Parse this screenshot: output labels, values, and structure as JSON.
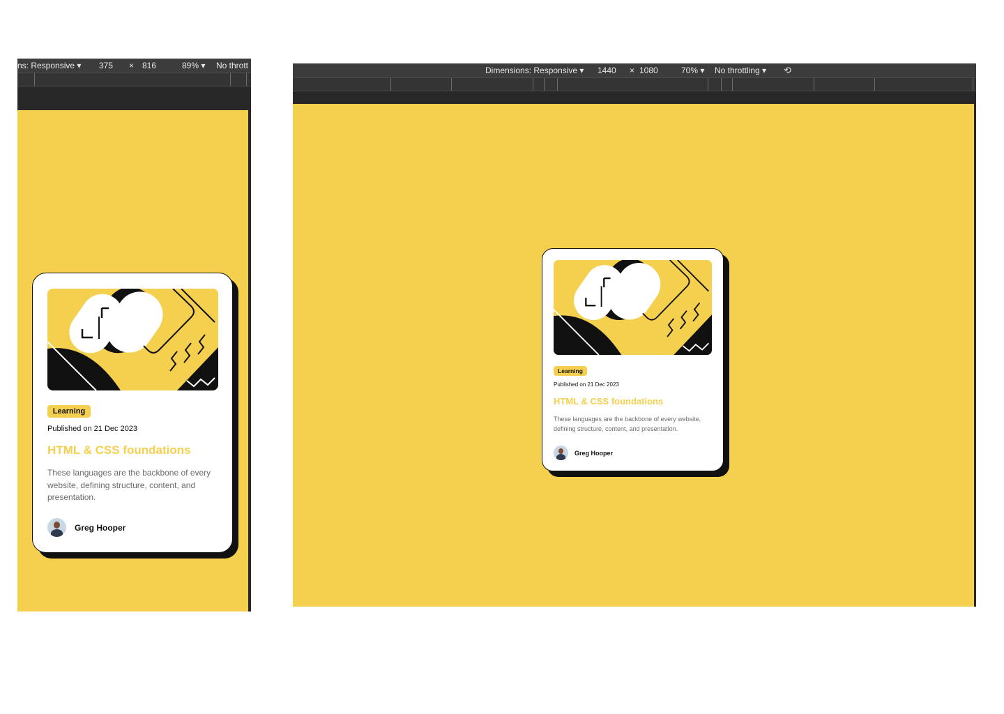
{
  "mobile_preview": {
    "toolbar": {
      "dimensions_label": "ns: Responsive ▾",
      "width": "375",
      "times": "×",
      "height": "816",
      "zoom": "89% ▾",
      "throttling": "No thrott"
    }
  },
  "desktop_preview": {
    "toolbar": {
      "dimensions_label": "Dimensions: Responsive ▾",
      "width": "1440",
      "times": "×",
      "height": "1080",
      "zoom": "70% ▾",
      "throttling": "No throttling ▾",
      "rotate_icon": "rotate-icon"
    }
  },
  "card": {
    "tag": "Learning",
    "published": "Published on 21 Dec 2023",
    "title": "HTML & CSS foundations",
    "description": "These languages are the backbone of every website, defining structure, content, and presentation.",
    "author": "Greg Hooper"
  },
  "colors": {
    "background_yellow": "#f4d04e",
    "ink": "#111111",
    "card": "#ffffff",
    "description_gray": "#6b6b6b",
    "devtools_dark": "#3c3c3c"
  }
}
